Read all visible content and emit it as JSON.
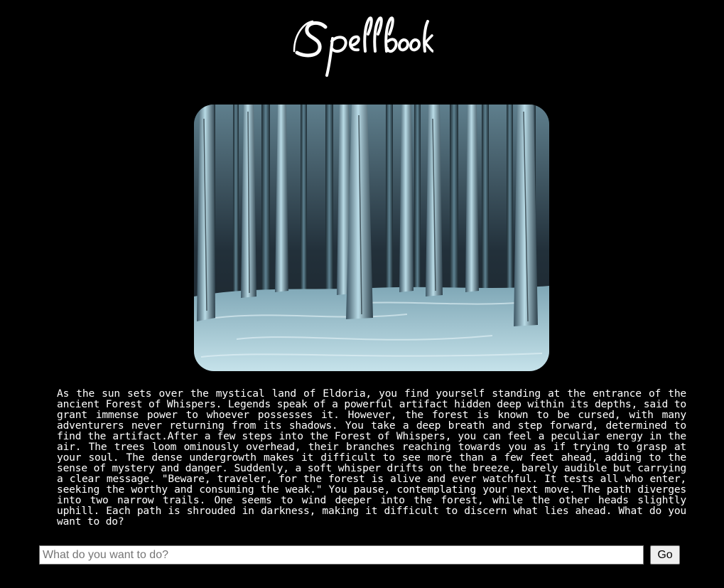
{
  "app": {
    "logo_text": "Spellbook"
  },
  "scene": {
    "image_icon": "forest-scene-image"
  },
  "story": {
    "text": "As the sun sets over the mystical land of Eldoria, you find yourself standing at the entrance of the ancient Forest of Whispers. Legends speak of a powerful artifact hidden deep within its depths, said to grant immense power to whoever possesses it. However, the forest is known to be cursed, with many adventurers never returning from its shadows. You take a deep breath and step forward, determined to find the artifact.After a few steps into the Forest of Whispers, you can feel a peculiar energy in the air. The trees loom ominously overhead, their branches reaching towards you as if trying to grasp at your soul. The dense undergrowth makes it difficult to see more than a few feet ahead, adding to the sense of mystery and danger. Suddenly, a soft whisper drifts on the breeze, barely audible but carrying a clear message. \"Beware, traveler, for the forest is alive and ever watchful. It tests all who enter, seeking the worthy and consuming the weak.\" You pause, contemplating your next move. The path diverges into two narrow trails. One seems to wind deeper into the forest, while the other heads slightly uphill. Each path is shrouded in darkness, making it difficult to discern what lies ahead. What do you want to do?"
  },
  "command": {
    "placeholder": "What do you want to do?",
    "value": "",
    "go_label": "Go"
  },
  "colors": {
    "background": "#000000",
    "text": "#ffffff",
    "forest_tint": "#9ec9d8"
  }
}
